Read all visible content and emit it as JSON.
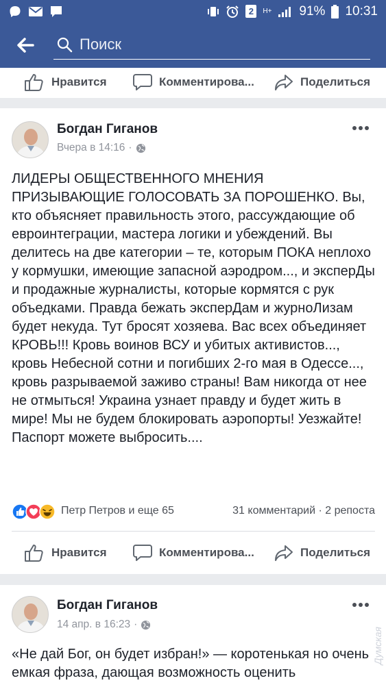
{
  "status_bar": {
    "battery": "91%",
    "time": "10:31",
    "sim_badge": "2",
    "network": "H+",
    "icons": [
      "viber-icon",
      "mail-icon",
      "messenger-icon",
      "vibrate-icon",
      "alarm-icon",
      "sim-icon",
      "network-icon",
      "signal-icon",
      "battery-icon"
    ]
  },
  "search": {
    "placeholder": "Поиск"
  },
  "actions": {
    "like": "Нравится",
    "comment": "Комментирова...",
    "share": "Поделиться"
  },
  "posts": [
    {
      "author": "Богдан Гиганов",
      "time": "Вчера в 14:16",
      "privacy_icon": "globe-icon",
      "text": "ЛИДЕРЫ ОБЩЕСТВЕННОГО МНЕНИЯ ПРИЗЫВАЮЩИЕ ГОЛОСОВАТЬ ЗА ПОРОШЕНКО. Вы, кто объясняет правильность этого, рассуждающие об евроинтеграции, мастера логики и убеждений. Вы делитесь на две категории – те, которым ПОКА неплохо у кормушки, имеющие запасной аэродром..., и эксперДы и продажные журналисты, которые кормятся с рук объедками. Правда бежать эксперДам и журноЛизам будет некуда. Тут бросят хозяева. Вас всех объединяет КРОВЬ!!! Кровь воинов ВСУ и убитых активистов..., кровь Небесной сотни и погибших 2-го мая в Одессе..., кровь разрываемой заживо страны! Вам никогда от нее не отмыться! Украина узнает правду и будет жить в мире! Мы не будем блокировать аэропорты! Уезжайте! Паспорт можете выбросить....",
      "reaction_names": "Петр Петров и еще 65",
      "reaction_icons": [
        "like-reaction-icon",
        "love-reaction-icon",
        "haha-reaction-icon"
      ],
      "comments": "31 комментарий",
      "reposts": "2 репоста"
    },
    {
      "author": "Богдан Гиганов",
      "time": "14 апр. в 16:23",
      "privacy_icon": "globe-icon",
      "text": "«Не дай Бог, он будет избран!» — коротенькая но очень емкая фраза, дающая возможность оценить"
    }
  ],
  "watermark": "Думская"
}
